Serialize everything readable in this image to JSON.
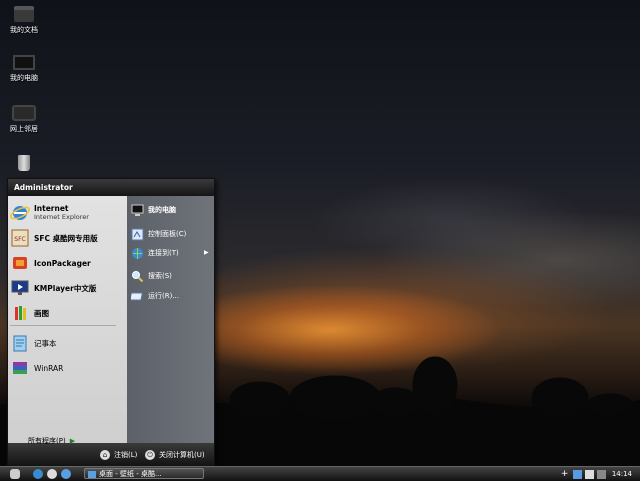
{
  "desktop": {
    "icons": [
      {
        "label": "我的文档",
        "icon": "folder-icon"
      },
      {
        "label": "我的电脑",
        "icon": "computer-icon"
      },
      {
        "label": "网上邻居",
        "icon": "network-icon"
      }
    ]
  },
  "start_menu": {
    "user_name": "Administrator",
    "programs": [
      {
        "title": "Internet",
        "subtitle": "Internet Explorer",
        "icon": "internet-explorer-icon"
      },
      {
        "title": "SFC 桌酷网专用版",
        "icon": "sfc-icon"
      },
      {
        "title": "IconPackager",
        "icon": "iconpackager-icon"
      },
      {
        "title": "KMPlayer中文版",
        "icon": "kmplayer-icon"
      },
      {
        "title": "画图",
        "icon": "paint-icon"
      },
      {
        "title": "记事本",
        "icon": "notepad-icon"
      },
      {
        "title": "WinRAR",
        "icon": "winrar-icon"
      }
    ],
    "all_programs": "所有程序(P)",
    "right_items": [
      {
        "label": "我的电脑",
        "icon": "my-computer-icon"
      },
      {
        "label": "控制面板(C)",
        "icon": "control-panel-icon"
      },
      {
        "label": "连接到(T)",
        "icon": "connect-to-icon"
      },
      {
        "label": "搜索(S)",
        "icon": "search-icon"
      },
      {
        "label": "运行(R)...",
        "icon": "run-icon"
      }
    ],
    "logoff": "注销(L)",
    "shutdown": "关闭计算机(U)"
  },
  "taskbar": {
    "task_label": "桌面 - 壁纸 - 桌酷...",
    "clock": "14:14"
  },
  "colors": {
    "menu_header": "#1a1a1a",
    "menu_left": "#d7d7d7",
    "menu_right": "#666a71",
    "taskbar": "#2a2a2a"
  }
}
